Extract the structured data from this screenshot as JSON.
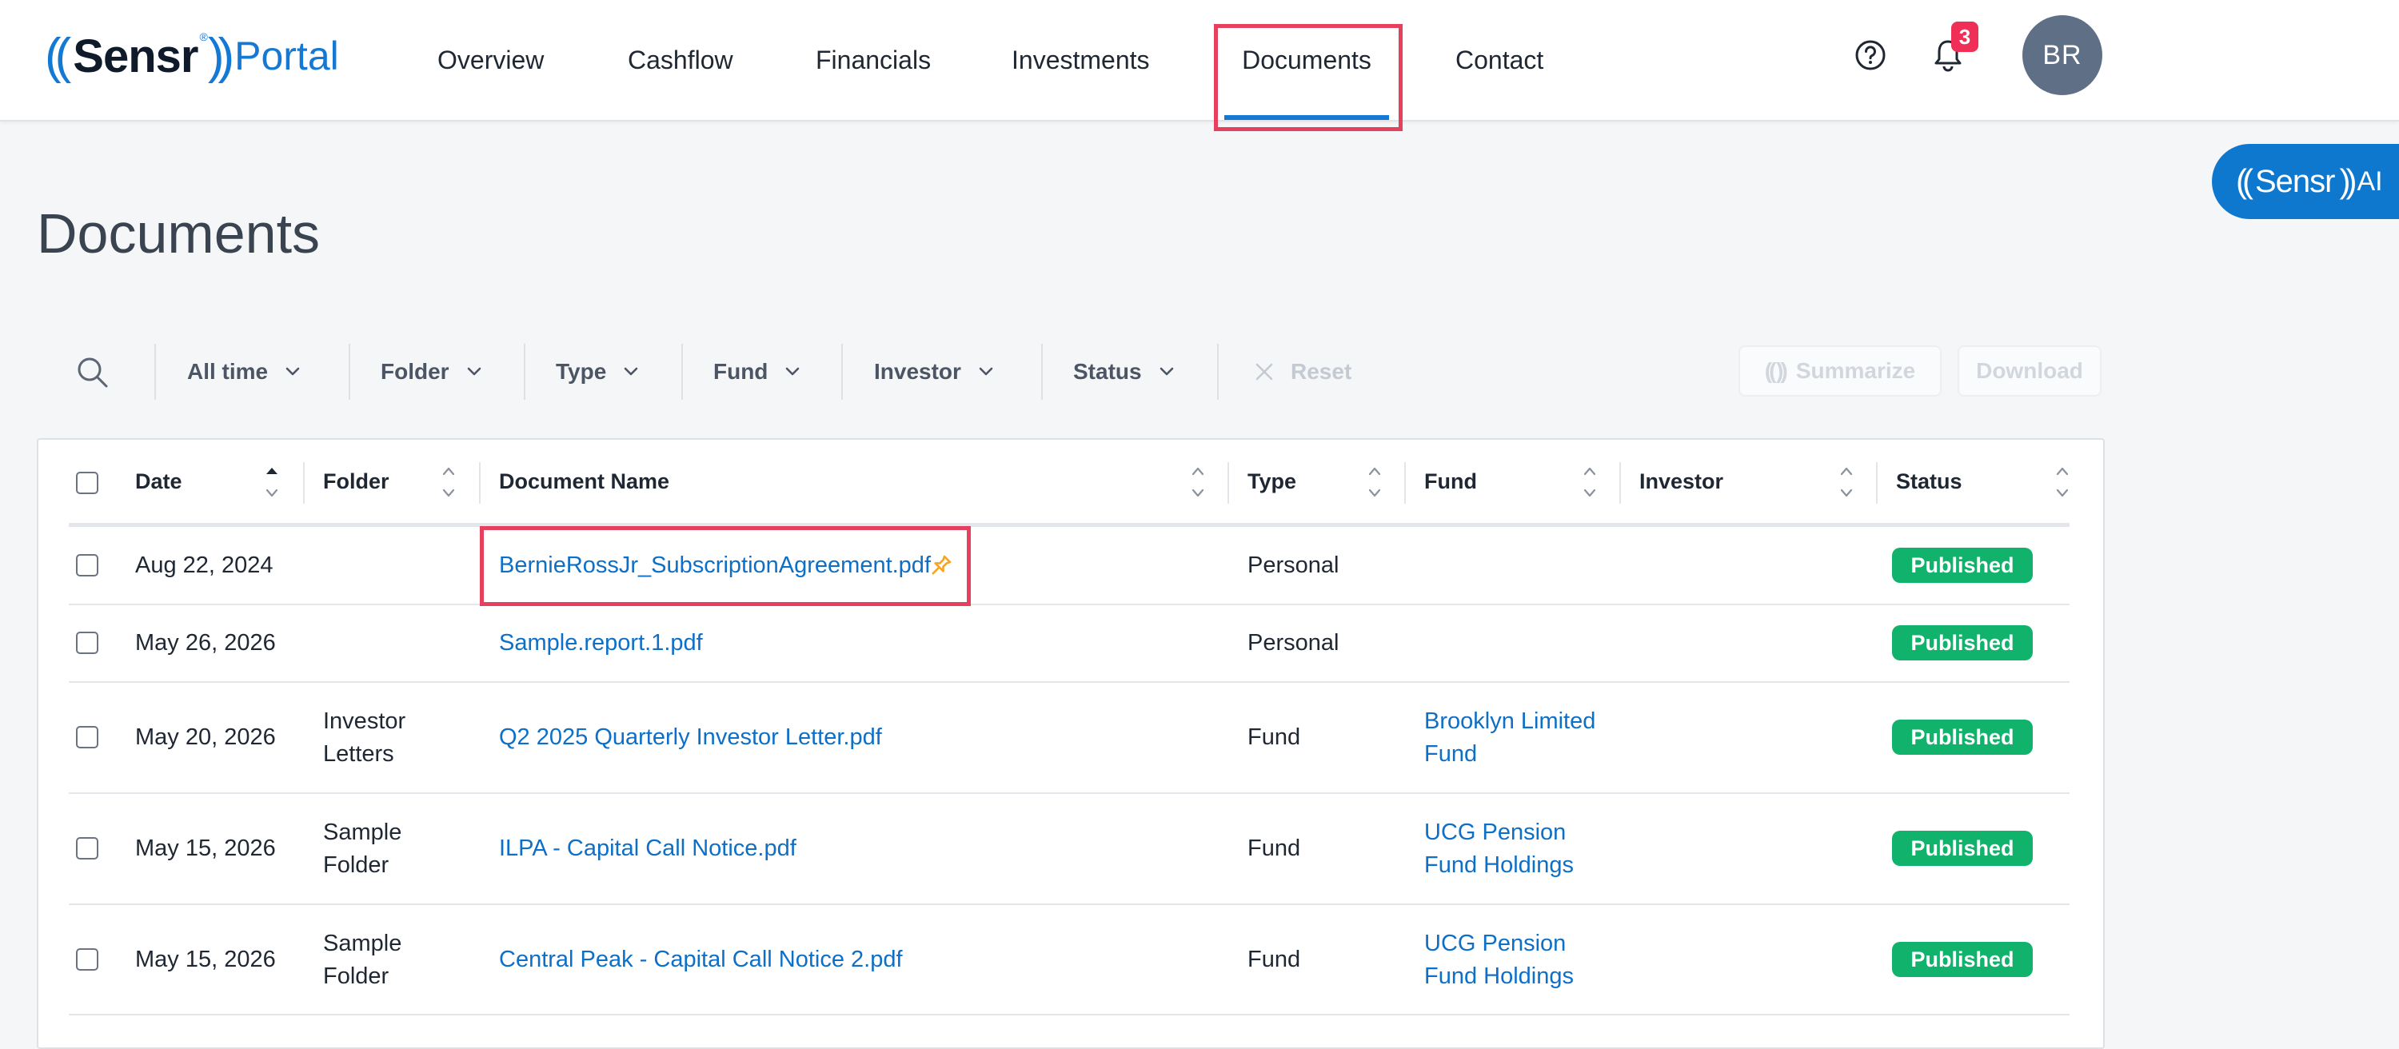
{
  "app": {
    "logo_brand": "Sensr",
    "logo_product": "Portal",
    "notifications_count": "3",
    "user_initials": "BR",
    "ai_button_brand": "Sensr",
    "ai_button_suffix": "AI"
  },
  "nav": {
    "items": [
      {
        "label": "Overview"
      },
      {
        "label": "Cashflow"
      },
      {
        "label": "Financials"
      },
      {
        "label": "Investments"
      },
      {
        "label": "Documents",
        "active": true
      },
      {
        "label": "Contact"
      }
    ]
  },
  "page": {
    "title": "Documents"
  },
  "filters": {
    "items": [
      {
        "label": "All time"
      },
      {
        "label": "Folder"
      },
      {
        "label": "Type"
      },
      {
        "label": "Fund"
      },
      {
        "label": "Investor"
      },
      {
        "label": "Status"
      }
    ],
    "reset_label": "Reset",
    "summarize_label": "Summarize",
    "download_label": "Download"
  },
  "table": {
    "columns": [
      "Date",
      "Folder",
      "Document Name",
      "Type",
      "Fund",
      "Investor",
      "Status"
    ],
    "rows": [
      {
        "date": "Aug 22, 2024",
        "folder": [
          "",
          ""
        ],
        "document": "BernieRossJr_SubscriptionAgreement.pdf",
        "pinned": true,
        "type": "Personal",
        "fund": [
          "",
          ""
        ],
        "investor": "",
        "status": "Published"
      },
      {
        "date": "May 26, 2026",
        "folder": [
          "",
          ""
        ],
        "document": "Sample.report.1.pdf",
        "pinned": false,
        "type": "Personal",
        "fund": [
          "",
          ""
        ],
        "investor": "",
        "status": "Published"
      },
      {
        "date": "May 20, 2026",
        "folder": [
          "Investor",
          "Letters"
        ],
        "document": "Q2 2025 Quarterly Investor Letter.pdf",
        "pinned": false,
        "type": "Fund",
        "fund": [
          "Brooklyn Limited",
          "Fund"
        ],
        "investor": "",
        "status": "Published"
      },
      {
        "date": "May 15, 2026",
        "folder": [
          "Sample",
          "Folder"
        ],
        "document": "ILPA - Capital Call Notice.pdf",
        "pinned": false,
        "type": "Fund",
        "fund": [
          "UCG Pension",
          "Fund Holdings"
        ],
        "investor": "",
        "status": "Published"
      },
      {
        "date": "May 15, 2026",
        "folder": [
          "Sample",
          "Folder"
        ],
        "document": "Central Peak - Capital Call Notice 2.pdf",
        "pinned": false,
        "type": "Fund",
        "fund": [
          "UCG Pension",
          "Fund Holdings"
        ],
        "investor": "",
        "status": "Published"
      }
    ]
  },
  "colors": {
    "accent": "#1479d4",
    "link": "#0e6fc7",
    "published": "#10b26c",
    "badge": "#ef2f55",
    "annotation": "#e5405e",
    "pin": "#f5a524"
  }
}
